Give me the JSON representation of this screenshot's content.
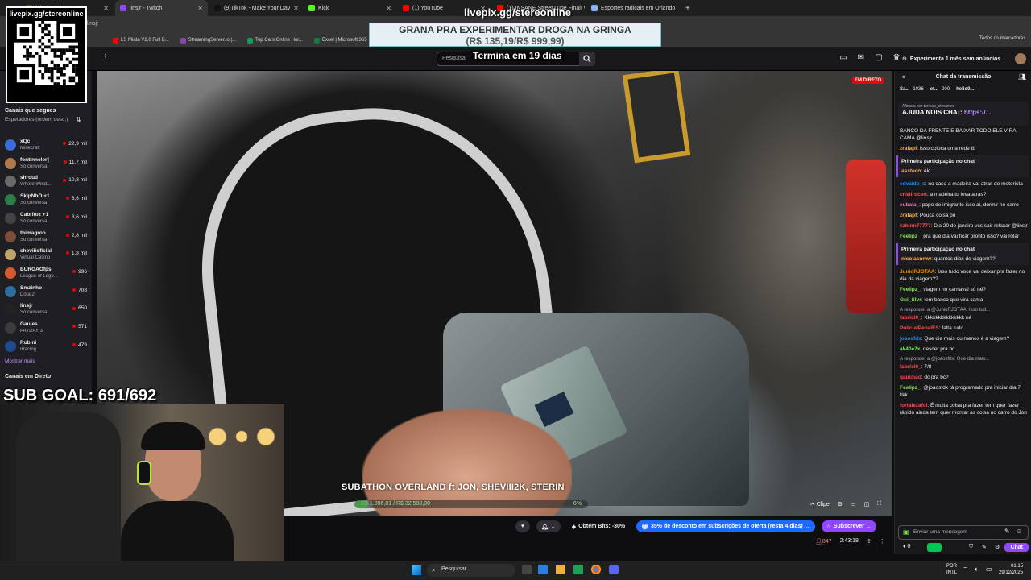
{
  "browser": {
    "tabs": [
      {
        "label": "(1) YouTube",
        "color": "#ff0000"
      },
      {
        "label": "linsjr - Twitch",
        "color": "#9147ff"
      },
      {
        "label": "(9)TikTok - Make Your Day",
        "color": "#111111"
      },
      {
        "label": "Kick",
        "color": "#53fc18"
      },
      {
        "label": "(1) YouTube",
        "color": "#ff0000"
      },
      {
        "label": "(1) INSANE Street Luge Final! W",
        "color": "#ff0000"
      },
      {
        "label": "Esportes radicais em Orlando",
        "color": "#8ab4f8"
      }
    ],
    "address": "linsjr",
    "bookmarks": [
      {
        "label": "LS Miata V2.0 Full B...",
        "color": "#ff0000"
      },
      {
        "label": "StreamingServer.io |...",
        "color": "#8e44ad"
      },
      {
        "label": "Top Cars Online Hor...",
        "color": "#0f9d58"
      },
      {
        "label": "Excel | Microsoft 365",
        "color": "#107c41"
      }
    ],
    "all_bookmarks": "Todos os marcadores"
  },
  "overlay": {
    "qr_label": "livepix.gg/stereonline",
    "url": "livepix.gg/stereonline",
    "banner_line1": "GRANA PRA EXPERIMENTAR DROGA NA GRINGA",
    "banner_line2": "(R$ 135,19/R$ 999,99)",
    "countdown": "Termina em 19 dias",
    "sub_goal": "SUB GOAL: 691/692",
    "subathon": "SUBATHON OVERLAND ft JON, SHEVIII2K, STERIN",
    "progress_left": "R$ 1.896,01 / R$ 32.500,00",
    "progress_right": "6%",
    "progress_fraction": 0.06
  },
  "twitch": {
    "search_placeholder": "Pesquisa",
    "prime": "Experimenta 1 mês sem anúncios",
    "live_badge": "EM DIRETO",
    "sidebar": {
      "followed_title": "Canais que segues",
      "sort": "Espetadores (ordem desc.)",
      "channels": [
        {
          "name": "xQc",
          "game": "Minecraft",
          "viewers": "22,9 mil",
          "color": "#3a6bd8"
        },
        {
          "name": "fontinneler]",
          "game": "Só conversa",
          "viewers": "11,7 mil",
          "color": "#b07a4d"
        },
        {
          "name": "shroud",
          "game": "Where Wind...",
          "viewers": "10,8 mil",
          "color": "#6a6a6a"
        },
        {
          "name": "SkipNhO +1",
          "game": "Só conversa",
          "viewers": "3,6 mil",
          "color": "#2d7d46"
        },
        {
          "name": "Cabritoz +1",
          "game": "Só conversa",
          "viewers": "3,6 mil",
          "color": "#444"
        },
        {
          "name": "thimagroo",
          "game": "Só conversa",
          "viewers": "2,8 mil",
          "color": "#7a4e3a"
        },
        {
          "name": "sheviiioficial",
          "game": "Virtual Casino",
          "viewers": "1,8 mil",
          "color": "#c0a46e"
        },
        {
          "name": "BURGAOfps",
          "game": "League of Lege...",
          "viewers": "996",
          "color": "#d45b2d"
        },
        {
          "name": "Smzinho",
          "game": "Dota 2",
          "viewers": "708",
          "color": "#2c6e9e"
        },
        {
          "name": "linsjr",
          "game": "Só conversa",
          "viewers": "650",
          "color": "#222"
        },
        {
          "name": "Gaules",
          "game": "PAYDAY 3",
          "viewers": "571",
          "color": "#3c3c3c"
        },
        {
          "name": "Rubini",
          "game": "iRacing",
          "viewers": "479",
          "color": "#1f4c91"
        }
      ],
      "show_more": "Mostrar mais",
      "live_channels": "Canais em Direto"
    },
    "player": {
      "clip": "Clipe"
    },
    "actions": {
      "bits": "Obtém Bits: -30%",
      "sale": "35% de desconto em subscrições de oferta (resta 4 dias)",
      "subscribe": "Subscrever",
      "viewers": "847",
      "uptime": "2:43:18"
    },
    "chat": {
      "title": "Chat da transmissão",
      "leaderboard": [
        {
          "name": "Sa...",
          "value": "1036"
        },
        {
          "name": "et...",
          "value": "200"
        },
        {
          "name": "helio0..."
        }
      ],
      "pinned_by": "Afixada por tonhao_streamer",
      "pinned_text": "AJUDA NOIS CHAT:",
      "pinned_link": "https://...",
      "messages": [
        {
          "type": "msg",
          "user": "",
          "color": "#efeff1",
          "text": "BANCO DA FRENTE E BAIXAR TODO ELE VIRA CAMA @linsjr"
        },
        {
          "type": "msg",
          "user": "zrafapf",
          "color": "#ffb347",
          "text": ": Isso coloca uma rede tb"
        },
        {
          "type": "first",
          "header": "Primeira participação no chat",
          "user": "asstecn",
          "color": "#ffb347",
          "text": ": Ak"
        },
        {
          "type": "msg",
          "user": "edvaldo_s",
          "color": "#1e90ff",
          "text": ": no caso a madeira vai atras do motorista"
        },
        {
          "type": "msg",
          "user": "cristirocert",
          "color": "#ff4f4f",
          "text": ": a madeira tu leva atras?"
        },
        {
          "type": "msg",
          "user": "eubaia_",
          "color": "#ff69b4",
          "text": ": papo de imigrante isso ai, dormir no carro"
        },
        {
          "type": "msg",
          "user": "zrafapf",
          "color": "#ffb347",
          "text": ": Pouca coisa po"
        },
        {
          "type": "msg",
          "user": "kzhinn77777",
          "color": "#ff4f4f",
          "text": ": Dia 20 de janeiro vcs sair relaxar @linsjr"
        },
        {
          "type": "msg",
          "user": "Feelipz_",
          "color": "#7ce84a",
          "text": ": pra que dia vai ficar pronto isso? vai rolar"
        },
        {
          "type": "first",
          "header": "Primeira participação no chat",
          "user": "nicolasnmw",
          "color": "#ffb347",
          "text": ": quantos dias de viagem??"
        },
        {
          "type": "msg",
          "user": "JunioRJOTAA",
          "color": "#ff8c00",
          "text": ": Isso tudo voce vai deixar pra fazer no dia da viagem??"
        },
        {
          "type": "msg",
          "user": "Feelipz_",
          "color": "#7ce84a",
          "text": ": viagem no carnaval só né?"
        },
        {
          "type": "msg",
          "user": "Gui_Slvr",
          "color": "#7ce84a",
          "text": ": tem banco que vira cama"
        },
        {
          "type": "reply",
          "text": "A responder a @JunioRJOTAA: Isso tud..."
        },
        {
          "type": "msg",
          "user": "fabrlcl0_",
          "color": "#ff4f4f",
          "text": ": Kkkkkkkkkkkkkkk né"
        },
        {
          "type": "msg",
          "user": "PolicialPenalES",
          "color": "#ff4f4f",
          "text": ": falta tudo"
        },
        {
          "type": "msg",
          "user": "joaosfdx",
          "color": "#1e90ff",
          "text": ": Que dia mais ou menos é a viagem?"
        },
        {
          "type": "msg",
          "user": "ak40e7x",
          "color": "#7ce84a",
          "text": ": descer pra bc"
        },
        {
          "type": "reply",
          "text": "A responder a @joaosfdx: Que dia mais..."
        },
        {
          "type": "msg",
          "user": "fabrlcl0_",
          "color": "#ff4f4f",
          "text": ": 7/8"
        },
        {
          "type": "msg",
          "user": "gauchao",
          "color": "#ff4f4f",
          "text": ": dc pra bc?"
        },
        {
          "type": "msg",
          "user": "Feelipz_",
          "color": "#7ce84a",
          "text": ": @joaosfdx tá programado pra iniciar dia 7 kkk"
        },
        {
          "type": "msg",
          "user": "fortalezafcl",
          "color": "#ff4f4f",
          "text": ": É muita coisa pra fazer tem quer fazer rápido ainda tem quer montar as coisa no carro do Jon"
        }
      ],
      "input_placeholder": "Enviar uma mensagem",
      "points": "0",
      "chat_button": "Chat"
    }
  },
  "taskbar": {
    "search": "Pesquisar",
    "lang_top": "POR",
    "lang_bottom": "INTL",
    "time": "01:15",
    "date": "29/12/2025"
  }
}
